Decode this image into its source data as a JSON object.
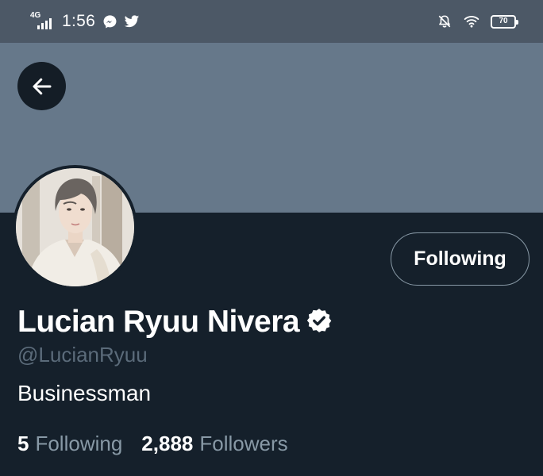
{
  "status_bar": {
    "network": "4G",
    "time": "1:56",
    "battery": "70",
    "icons": [
      "messenger-icon",
      "twitter-icon",
      "notifications-off-icon",
      "wifi-icon"
    ]
  },
  "header": {
    "back_icon": "arrow-left-icon",
    "banner_color": "#66788a"
  },
  "profile": {
    "display_name": "Lucian Ryuu Nivera",
    "handle": "@LucianRyuu",
    "bio": "Businessman",
    "verified_icon": "verified-badge-icon",
    "follow_button_label": "Following",
    "following_count": "5",
    "following_label": "Following",
    "followers_count": "2,888",
    "followers_label": "Followers"
  },
  "colors": {
    "background": "#15202b",
    "status_bar": "#4c5866",
    "secondary_text": "#8899a6",
    "handle_text": "#5b6b7a"
  }
}
